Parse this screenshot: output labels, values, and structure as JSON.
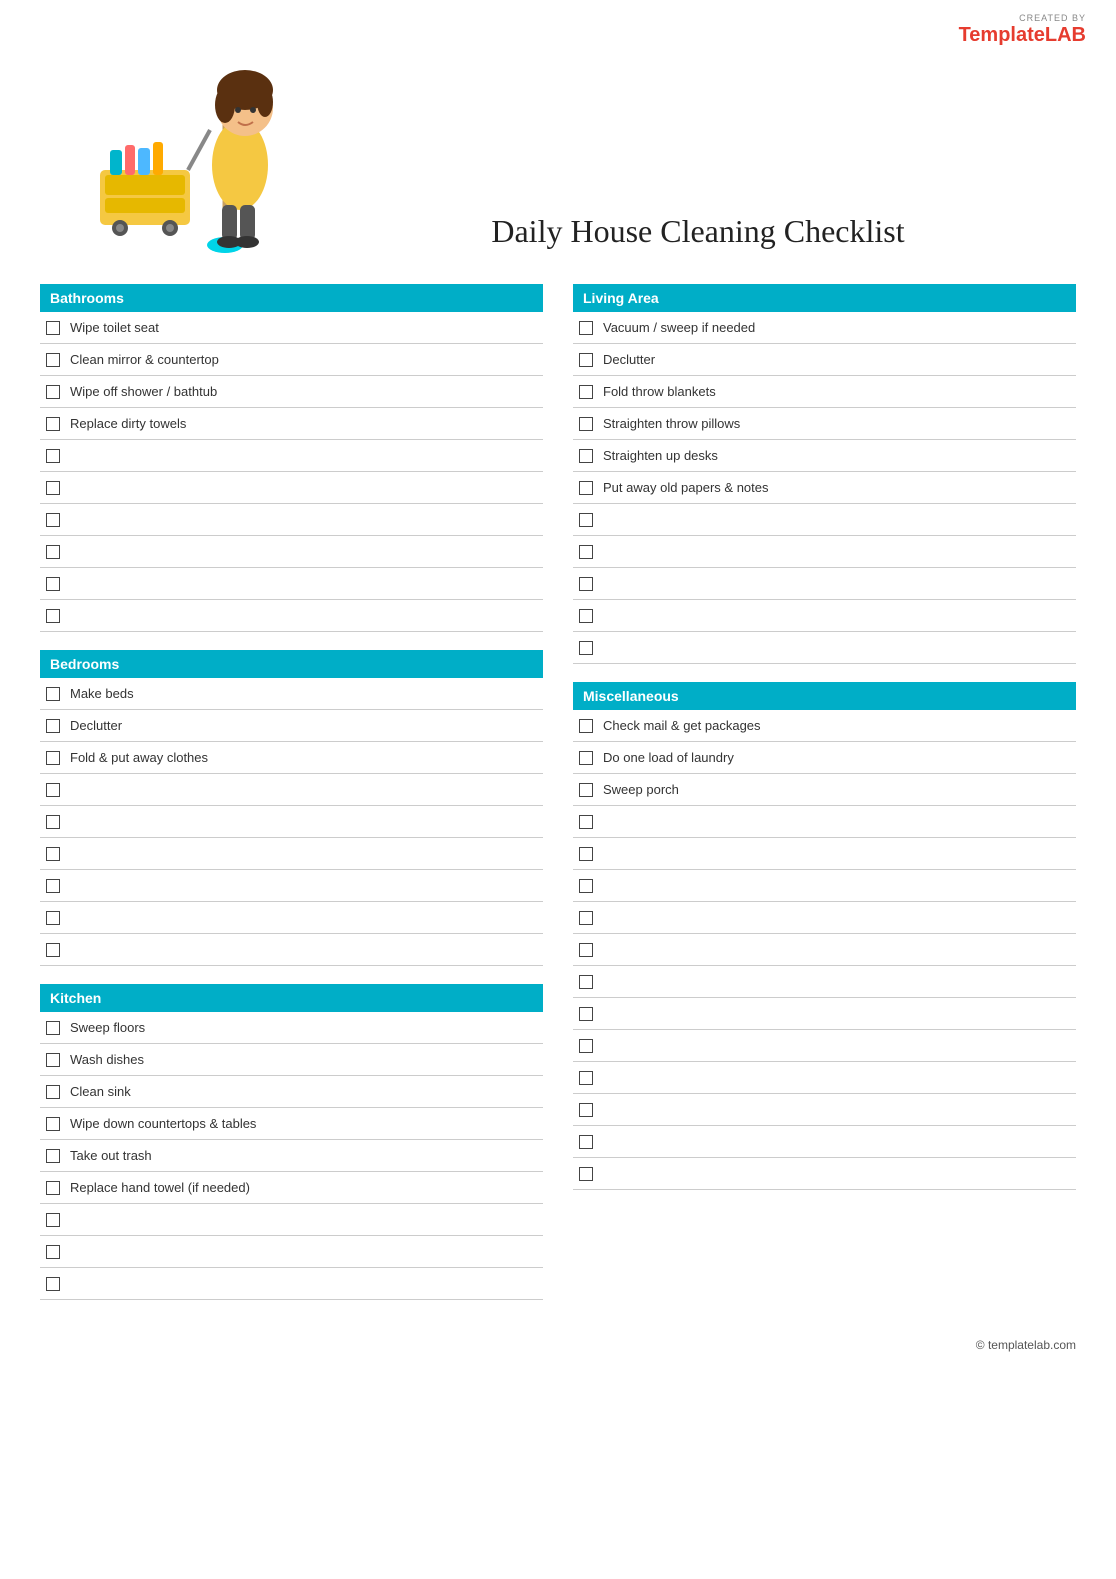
{
  "logo": {
    "created_by": "CREATED BY",
    "template": "Template",
    "lab": "LAB"
  },
  "title": "Daily House Cleaning Checklist",
  "sections": {
    "left": [
      {
        "id": "bathrooms",
        "header": "Bathrooms",
        "items": [
          "Wipe toilet seat",
          "Clean mirror & countertop",
          "Wipe off shower / bathtub",
          "Replace dirty towels",
          "",
          "",
          "",
          "",
          "",
          ""
        ]
      },
      {
        "id": "bedrooms",
        "header": "Bedrooms",
        "items": [
          "Make beds",
          "Declutter",
          "Fold & put away clothes",
          "",
          "",
          "",
          "",
          "",
          ""
        ]
      },
      {
        "id": "kitchen",
        "header": "Kitchen",
        "items": [
          "Sweep floors",
          "Wash dishes",
          "Clean sink",
          "Wipe down countertops & tables",
          "Take out trash",
          "Replace hand towel (if needed)",
          "",
          "",
          ""
        ]
      }
    ],
    "right": [
      {
        "id": "living-area",
        "header": "Living Area",
        "items": [
          "Vacuum / sweep if needed",
          "Declutter",
          "Fold throw blankets",
          "Straighten throw pillows",
          "Straighten up desks",
          "Put away old papers & notes",
          "",
          "",
          "",
          "",
          ""
        ]
      },
      {
        "id": "miscellaneous",
        "header": "Miscellaneous",
        "items": [
          "Check mail & get packages",
          "Do one load of laundry",
          "Sweep porch",
          "",
          "",
          "",
          "",
          "",
          "",
          "",
          "",
          "",
          "",
          "",
          ""
        ]
      }
    ]
  },
  "footer": {
    "copyright": "© templatelab.com"
  }
}
